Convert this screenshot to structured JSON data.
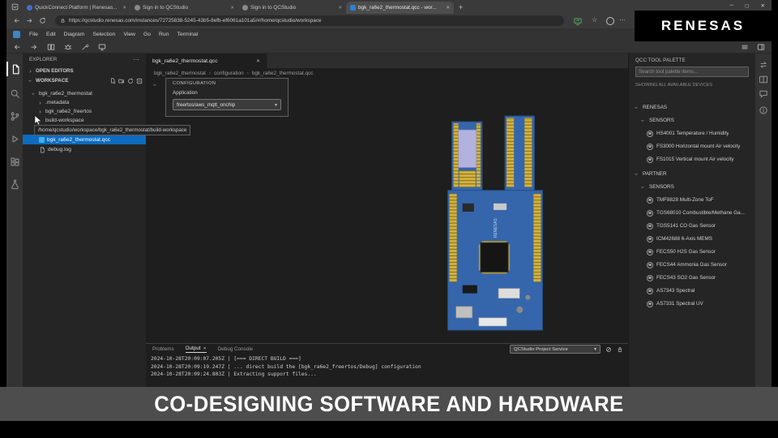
{
  "icons": {
    "minimize": "─",
    "maximize": "◻",
    "close": "✕",
    "new_tab": "+",
    "star": "☆",
    "more": "…"
  },
  "banner": {
    "text": "CO-DESIGNING SOFTWARE AND HARDWARE"
  },
  "watermark": {
    "brand": "RENESAS"
  },
  "browser": {
    "tabs": [
      {
        "title": "QuickConnect Platform | Renesas..."
      },
      {
        "title": "Sign in to QCStudio"
      },
      {
        "title": "Sign in to QCStudio"
      },
      {
        "title": "bgk_ra6e2_thermostat.qcc - wor..."
      }
    ],
    "active_tab_index": 3,
    "url": "https://qcstudio.renesas.com/instances/72725838-5245-43b5-8efb-ef6061a101a5/#/home/qcstudio/workspace"
  },
  "menu": {
    "items": [
      "File",
      "Edit",
      "Diagram",
      "Selection",
      "View",
      "Go",
      "Run",
      "Terminal"
    ]
  },
  "explorer": {
    "title": "EXPLORER",
    "open_editors": "OPEN EDITORS",
    "workspace": "WORKSPACE",
    "items": [
      {
        "label": "bgk_ra6e2_thermostat"
      },
      {
        "label": ".metadata"
      },
      {
        "label": "bgk_ra6e2_freertos"
      },
      {
        "label": "build-workspace"
      },
      {
        "label": "bgk_ra6e2_thermostat.qcc",
        "selected": true
      },
      {
        "label": "debug.log"
      }
    ],
    "tooltip": "/home/qcstudio/workspace/bgk_ra6e2_thermostat/build-workspace"
  },
  "editor": {
    "tab_title": "bgk_ra6e2_thermostat.qcc",
    "breadcrumb": [
      "bgk_ra6e2_thermostat",
      "configuration",
      "bgk_ra6e2_thermostat.qcc"
    ],
    "config": {
      "title": "CONFIGURATION",
      "label": "Application",
      "value": "freertos/aws_mqtt_onchip"
    }
  },
  "palette": {
    "title": "QCC TOOL PALETTE",
    "search_placeholder": "Search tool palette items...",
    "subtitle": "SHOWING ALL AVAILABLE DEVICES",
    "vendor_1": "RENESAS",
    "vendor_1_section": "SENSORS",
    "renesas_sensors": [
      "HS4001 Temperature / Humidity",
      "FS3000 Horizontal mount Air velocity",
      "FS1015 Vertical mount Air velocity"
    ],
    "vendor_2": "PARTNER",
    "vendor_2_section": "SENSORS",
    "partner_sensors": [
      "TMF8828 Multi-Zone ToF",
      "TGS68010 Combustible/Methane Ga...",
      "TGS5141 CO Gas Sensor",
      "ICM42688 6-Axis MEMS",
      "FECS50 H2S Gas Sensor",
      "FECS44 Ammonia Gas Sensor",
      "FECS43 SO2 Gas Sensor",
      "AS7343 Spectral",
      "AS7331 Spectral UV"
    ]
  },
  "panel": {
    "tabs": [
      "Problems",
      "Output",
      "Debug Console"
    ],
    "active_tab": "Output",
    "service": "QCStudio Project Service",
    "logs": [
      "2024-10-28T20:09:07.205Z | [=== DIRECT BUILD ===]",
      "2024-10-28T20:09:19.247Z | ... direct build the [bgk_ra6e2_freertos/Debug] configuration",
      "2024-10-28T20:09:24.803Z | Extracting support files..."
    ]
  },
  "colors": {
    "selection": "#0d6cbf",
    "banner_bg": "#4d4d4d",
    "pcb_blue": "#3566ab"
  }
}
